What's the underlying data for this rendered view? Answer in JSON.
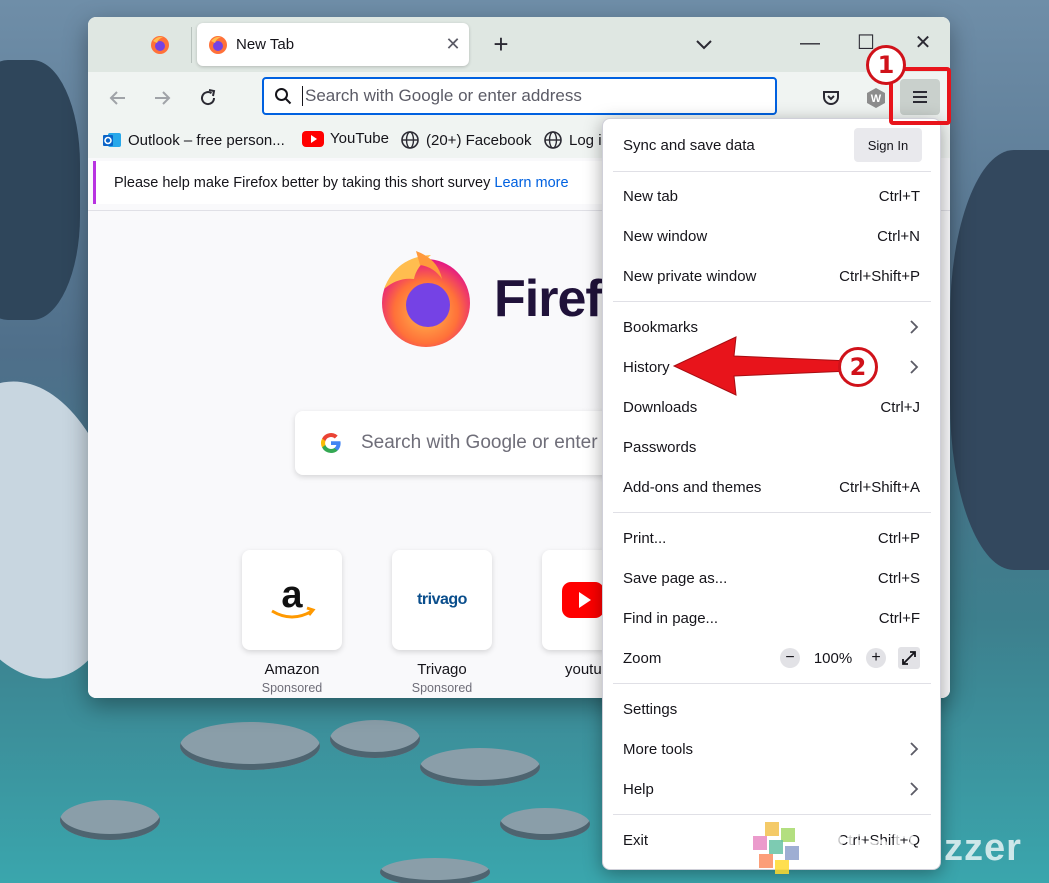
{
  "tabs": {
    "active_title": "New Tab",
    "close_glyph": "✕",
    "new_tab_glyph": "+",
    "list_glyph": "⌄"
  },
  "window": {
    "minimize": "—",
    "maximize": "☐",
    "close": "✕"
  },
  "urlbar": {
    "placeholder": "Search with Google or enter address",
    "value": ""
  },
  "bookmarks": [
    {
      "label": "Outlook – free person...",
      "icon": "outlook-icon"
    },
    {
      "label": "YouTube",
      "icon": "youtube-icon"
    },
    {
      "label": "(20+) Facebook",
      "icon": "globe-icon"
    },
    {
      "label": "Log i",
      "icon": "globe-icon"
    }
  ],
  "notice": {
    "text": "Please help make Firefox better by taking this short survey",
    "link": "Learn more"
  },
  "newtab": {
    "brand": "Firef",
    "search_placeholder": "Search with Google or enter a",
    "top_sites": [
      {
        "name": "Amazon",
        "sub": "Sponsored"
      },
      {
        "name": "Trivago",
        "sub": "Sponsored"
      },
      {
        "name": "youtu",
        "sub": ""
      }
    ],
    "trivago_logo": "trivago"
  },
  "menu": {
    "sync_label": "Sync and save data",
    "sign_in": "Sign In",
    "new_tab": {
      "label": "New tab",
      "shortcut": "Ctrl+T"
    },
    "new_window": {
      "label": "New window",
      "shortcut": "Ctrl+N"
    },
    "new_private": {
      "label": "New private window",
      "shortcut": "Ctrl+Shift+P"
    },
    "bookmarks": {
      "label": "Bookmarks"
    },
    "history": {
      "label": "History"
    },
    "downloads": {
      "label": "Downloads",
      "shortcut": "Ctrl+J"
    },
    "passwords": {
      "label": "Passwords"
    },
    "addons": {
      "label": "Add-ons and themes",
      "shortcut": "Ctrl+Shift+A"
    },
    "print": {
      "label": "Print...",
      "shortcut": "Ctrl+P"
    },
    "save_page": {
      "label": "Save page as...",
      "shortcut": "Ctrl+S"
    },
    "find": {
      "label": "Find in page...",
      "shortcut": "Ctrl+F"
    },
    "zoom": {
      "label": "Zoom",
      "minus": "−",
      "value": "100%",
      "plus": "+"
    },
    "settings": {
      "label": "Settings"
    },
    "more_tools": {
      "label": "More tools"
    },
    "help": {
      "label": "Help"
    },
    "exit": {
      "label": "Exit",
      "shortcut": "Ctrl+Shift+Q"
    }
  },
  "annotations": {
    "step1": "1",
    "step2": "2",
    "accent": "#e8141b"
  },
  "watermark": "WinBuzzer"
}
